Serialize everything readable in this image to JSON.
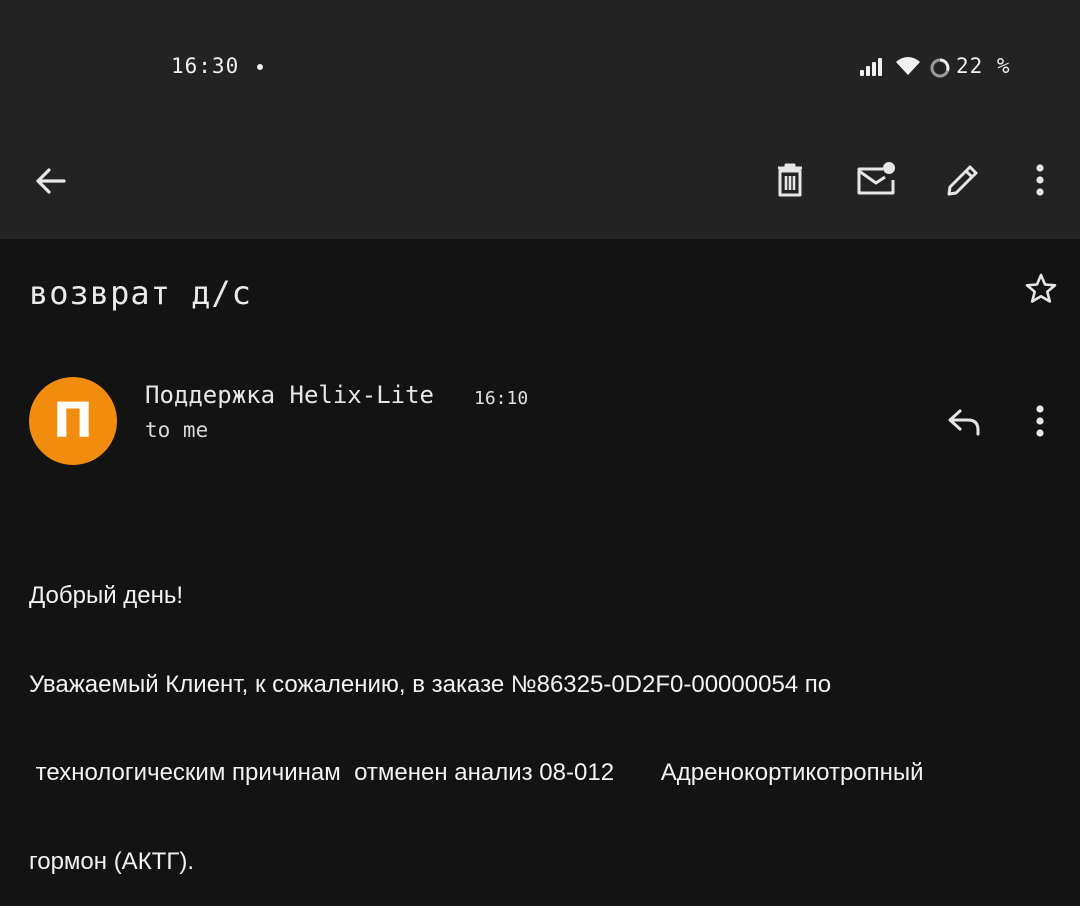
{
  "status_bar": {
    "time": "16:30",
    "battery_percent": "22 %",
    "icons": [
      "signal-icon",
      "wifi-icon",
      "battery-saver-ring-icon"
    ]
  },
  "toolbar": {
    "back_icon": "arrow-back-icon",
    "actions": [
      "delete-icon",
      "mark-unread-icon",
      "edit-icon",
      "more-vert-icon"
    ]
  },
  "email": {
    "subject": "возврат д/с",
    "starred": false,
    "sender": {
      "name": "Поддержка Helix-Lite",
      "time": "16:10",
      "recipients": "to me",
      "avatar_letter": "П",
      "avatar_color": "#f28c0f"
    },
    "body_lines": [
      "Добрый день!",
      "Уважаемый Клиент, к сожалению, в заказе №86325-0D2F0-00000054 по",
      " технологическим причинам  отменен анализ 08-012       Адренокортикотропный",
      "гормон (АКТГ)."
    ]
  },
  "colors": {
    "background": "#131313",
    "toolbar_background": "#232323",
    "text": "#e8e8e8",
    "accent_avatar": "#f28c0f"
  }
}
